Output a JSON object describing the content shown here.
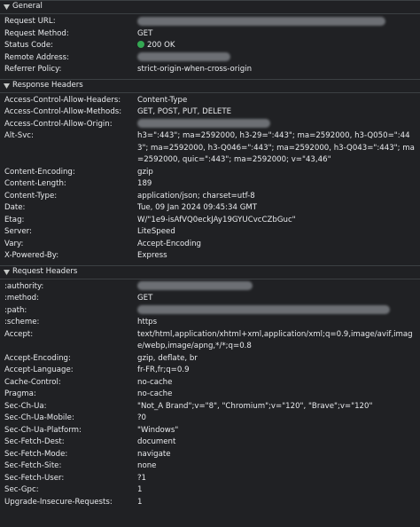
{
  "colors": {
    "background": "#202124",
    "text": "#e8eaed",
    "status_ok": "#34a853",
    "redaction": "#75787d"
  },
  "general": {
    "title": "General",
    "rows": [
      {
        "name": "Request URL:",
        "value": ""
      },
      {
        "name": "Request Method:",
        "value": "GET"
      },
      {
        "name": "Status Code:",
        "value": "200 OK"
      },
      {
        "name": "Remote Address:",
        "value": ""
      },
      {
        "name": "Referrer Policy:",
        "value": "strict-origin-when-cross-origin"
      }
    ]
  },
  "response": {
    "title": "Response Headers",
    "rows": [
      {
        "name": "Access-Control-Allow-Headers:",
        "value": "Content-Type"
      },
      {
        "name": "Access-Control-Allow-Methods:",
        "value": "GET, POST, PUT, DELETE"
      },
      {
        "name": "Access-Control-Allow-Origin:",
        "value": ""
      },
      {
        "name": "Alt-Svc:",
        "value": "h3=\":443\"; ma=2592000, h3-29=\":443\"; ma=2592000, h3-Q050=\":443\"; ma=2592000, h3-Q046=\":443\"; ma=2592000, h3-Q043=\":443\"; ma=2592000, quic=\":443\"; ma=2592000; v=\"43,46\""
      },
      {
        "name": "Content-Encoding:",
        "value": "gzip"
      },
      {
        "name": "Content-Length:",
        "value": "189"
      },
      {
        "name": "Content-Type:",
        "value": "application/json; charset=utf-8"
      },
      {
        "name": "Date:",
        "value": "Tue, 09 Jan 2024 09:45:34 GMT"
      },
      {
        "name": "Etag:",
        "value": "W/\"1e9-isAfVQ0eckJAy19GYUCvcCZbGuc\""
      },
      {
        "name": "Server:",
        "value": "LiteSpeed"
      },
      {
        "name": "Vary:",
        "value": "Accept-Encoding"
      },
      {
        "name": "X-Powered-By:",
        "value": "Express"
      }
    ]
  },
  "request": {
    "title": "Request Headers",
    "rows": [
      {
        "name": ":authority:",
        "value": ""
      },
      {
        "name": ":method:",
        "value": "GET"
      },
      {
        "name": ":path:",
        "value": ""
      },
      {
        "name": ":scheme:",
        "value": "https"
      },
      {
        "name": "Accept:",
        "value": "text/html,application/xhtml+xml,application/xml;q=0.9,image/avif,image/webp,image/apng,*/*;q=0.8"
      },
      {
        "name": "Accept-Encoding:",
        "value": "gzip, deflate, br"
      },
      {
        "name": "Accept-Language:",
        "value": "fr-FR,fr;q=0.9"
      },
      {
        "name": "Cache-Control:",
        "value": "no-cache"
      },
      {
        "name": "Pragma:",
        "value": "no-cache"
      },
      {
        "name": "Sec-Ch-Ua:",
        "value": "\"Not_A Brand\";v=\"8\", \"Chromium\";v=\"120\", \"Brave\";v=\"120\""
      },
      {
        "name": "Sec-Ch-Ua-Mobile:",
        "value": "?0"
      },
      {
        "name": "Sec-Ch-Ua-Platform:",
        "value": "\"Windows\""
      },
      {
        "name": "Sec-Fetch-Dest:",
        "value": "document"
      },
      {
        "name": "Sec-Fetch-Mode:",
        "value": "navigate"
      },
      {
        "name": "Sec-Fetch-Site:",
        "value": "none"
      },
      {
        "name": "Sec-Fetch-User:",
        "value": "?1"
      },
      {
        "name": "Sec-Gpc:",
        "value": "1"
      },
      {
        "name": "Upgrade-Insecure-Requests:",
        "value": "1"
      }
    ]
  }
}
